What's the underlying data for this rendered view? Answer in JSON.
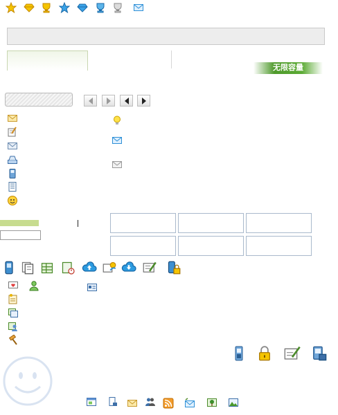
{
  "top_icons": [
    "star-gold-icon",
    "diamond-gold-icon",
    "trophy-gold-icon",
    "star-blue-icon",
    "diamond-blue-icon",
    "trophy-blue-icon",
    "trophy-gray-icon",
    "envelope-icon"
  ],
  "tabs": {
    "active_label": "",
    "second_label": ""
  },
  "badge": {
    "label": "无限容量"
  },
  "search": {
    "value": ""
  },
  "pager": {
    "labels": [
      "",
      "",
      "",
      ""
    ]
  },
  "left_menu": [
    "envelope-icon",
    "compose-icon",
    "inbox-icon",
    "drive-icon",
    "phone-icon",
    "notebook-icon",
    "emoticon-icon"
  ],
  "mid_menu": [
    "lightbulb-icon",
    "mail-blue-icon",
    "mail-gray-icon"
  ],
  "app_icons": [
    "mobile-icon",
    "documents-icon",
    "spreadsheet-icon",
    "calendar-icon",
    "cloud-upload-icon",
    "share-icon",
    "cloud-download-icon",
    "signature-icon",
    "lock-phone-icon"
  ],
  "lower_menu": [
    "message-heart-icon",
    "contact-icon",
    "card-icon",
    "notes-icon",
    "gallery-icon",
    "group-icon",
    "gavel-icon"
  ],
  "right_icons": [
    "sim-icon",
    "lock-icon",
    "edit-icon",
    "pda-icon"
  ],
  "footer_icons": [
    "window-icon",
    "bookmark-icon",
    "mail-icon",
    "people-icon",
    "rss-icon",
    "send-icon",
    "tree-icon",
    "picture-icon"
  ],
  "colors": {
    "gold": "#f5b500",
    "blue": "#2c8fd6",
    "green": "#5cab35",
    "gray": "#aaaaaa"
  }
}
